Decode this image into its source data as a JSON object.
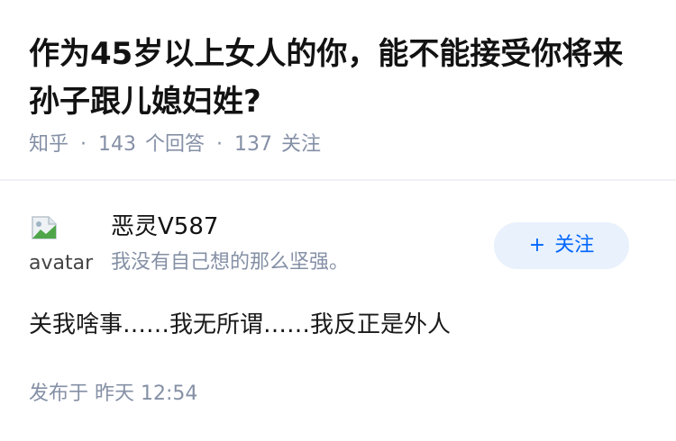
{
  "question": {
    "title": "作为45岁以上女人的你，能不能接受你将来孙子跟儿媳妇姓?",
    "meta": {
      "site": "知乎",
      "answer_count": "143",
      "answer_unit": "个回答",
      "follower_count": "137",
      "follower_unit": "关注"
    }
  },
  "answer": {
    "avatar_alt": "avatar",
    "author_name": "恶灵V587",
    "author_bio": "我没有自己想的那么坚强。",
    "follow_plus": "+",
    "follow_label": "关注",
    "content": "关我啥事……我无所谓……我反正是外人",
    "time_prefix": "发布于",
    "time_value": "昨天 12:54"
  },
  "colors": {
    "accent": "#0066ff",
    "follow_bg": "#e8f1fc",
    "meta_gray": "#8590a6",
    "divider": "#f0f2f5"
  },
  "icons": {
    "avatar": "broken-image-icon"
  }
}
